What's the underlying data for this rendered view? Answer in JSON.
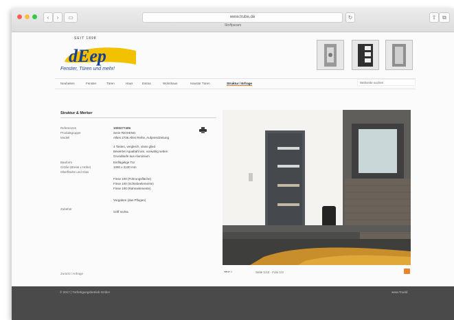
{
  "browser": {
    "url": "www.trube.de",
    "tab_title": "Stoffparam"
  },
  "brand": {
    "tagline_top": "SEIT 1898",
    "logo_text": "dEep",
    "slogan": "Fenster, Türen und mehr!",
    "colors": {
      "logo_blue": "#1b3f8f",
      "logo_yellow": "#f2c200",
      "accent": "#e07b2a"
    }
  },
  "nav": {
    "items": [
      "Neuheiten",
      "Fenster",
      "Türen",
      "Haus",
      "Extras",
      "Wohnhaus",
      "Haustür Türen",
      "Struktur / Erfrage"
    ],
    "search_placeholder": "Webseite suchen"
  },
  "detail": {
    "title": "Struktur & Merker",
    "rows": [
      {
        "label": "Referenzen",
        "value": "1000277406"
      },
      {
        "label": "Produktgruppe",
        "value": "Serie RIOXENG"
      },
      {
        "label": "Modell",
        "value": "Alltes 2736 Alles Reihe, Aufpreis/Zeitung"
      },
      {
        "label": "",
        "value": "4 Tasten, vergleich, vises glied"
      },
      {
        "label": "",
        "value": "Bewertet Aquabahl am, vorwahig setten"
      },
      {
        "label": "",
        "value": "Grundlaufe aus Aluminium"
      },
      {
        "label": "Bauform",
        "value": "Einflügelige Tür"
      },
      {
        "label": "Größe (Breite x Höhe)",
        "value": "1090 x 2130 mm"
      },
      {
        "label": "Oberfläche und Glas",
        "value": ""
      },
      {
        "label": "",
        "value": "Finse 100 (Führungsfläche)"
      },
      {
        "label": "",
        "value": "Finse 100 (Schiebeelemente)"
      },
      {
        "label": "",
        "value": "Finse 100 (Rahmelemente)"
      },
      {
        "label": "",
        "value": "Vorgaben (das Pflugen)"
      },
      {
        "label": "Zubehör",
        "value": "Griff rechts"
      }
    ],
    "back_link": "Zurück / Anfrage",
    "photo_caption": "Seite 1/10 · Foto 1/3"
  },
  "footer": {
    "left": "© 2017 | Türfertigungsbetrieb GmbH",
    "right": "www.Trueld"
  }
}
